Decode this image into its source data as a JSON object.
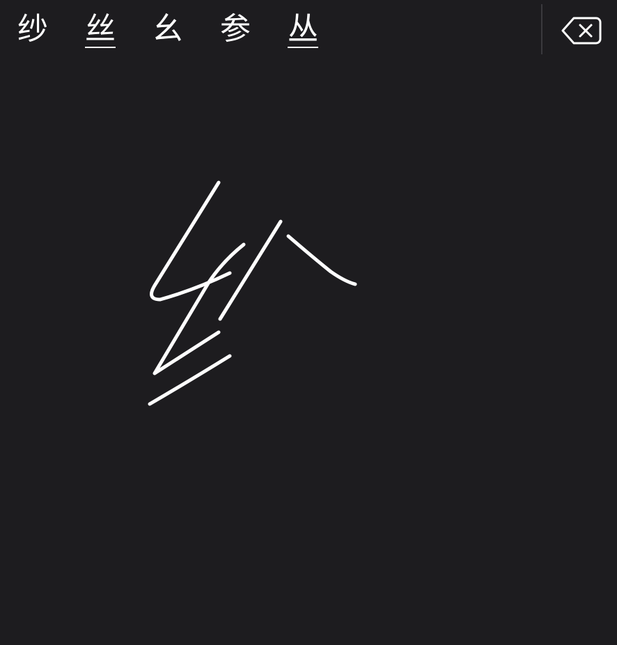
{
  "candidates": [
    "纱",
    "丝",
    "幺",
    "参",
    "丛"
  ],
  "underlined_candidates": [
    1,
    4
  ],
  "delete_icon": "backspace-icon",
  "colors": {
    "background": "#1d1c1f",
    "ink": "#ffffff",
    "divider": "#3a393d"
  }
}
